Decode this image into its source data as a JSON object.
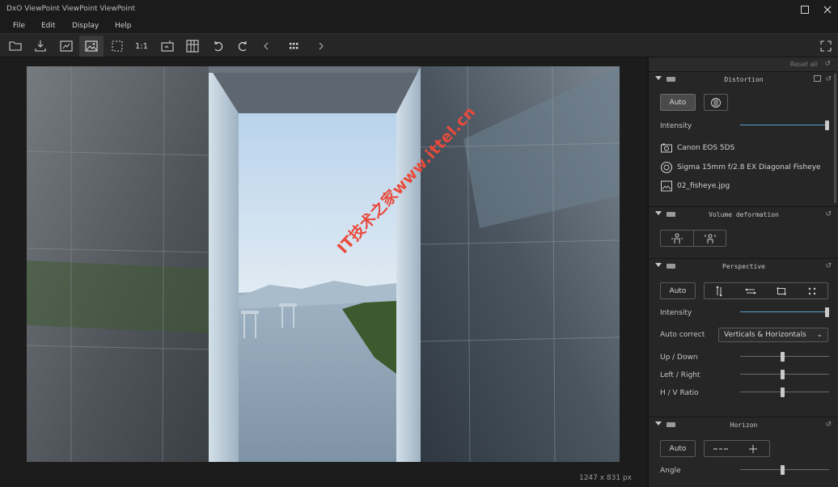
{
  "window": {
    "title": "DxO ViewPoint ViewPoint ViewPoint",
    "maximize_icon": "maximize-icon",
    "close_icon": "close-icon"
  },
  "menu": [
    "File",
    "Edit",
    "Display",
    "Help"
  ],
  "toolbar": {
    "items": [
      "open-icon",
      "export-icon",
      "compare-icon",
      "image-icon",
      "crop-icon",
      "1:1",
      "fit-icon",
      "grid-icon",
      "rotate-left-icon",
      "rotate-right-icon",
      "prev-icon",
      "thumbnails-icon",
      "next-icon",
      "fullscreen-icon"
    ],
    "zoom_label": "1:1"
  },
  "canvas": {
    "image_size": "1247 x 831 px"
  },
  "panel": {
    "reset_all": "Reset all",
    "distortion": {
      "title": "Distortion",
      "auto_label": "Auto",
      "intensity_label": "Intensity",
      "intensity_value": 1.0,
      "camera": "Canon EOS 5DS",
      "lens": "Sigma 15mm f/2.8 EX Diagonal Fisheye",
      "file": "02_fisheye.jpg"
    },
    "volume": {
      "title": "Volume deformation"
    },
    "perspective": {
      "title": "Perspective",
      "auto_label": "Auto",
      "intensity_label": "Intensity",
      "intensity_value": 1.0,
      "auto_correct_label": "Auto correct",
      "auto_correct_value": "Verticals & Horizontals",
      "up_down_label": "Up / Down",
      "left_right_label": "Left / Right",
      "hv_ratio_label": "H / V Ratio"
    },
    "horizon": {
      "title": "Horizon",
      "auto_label": "Auto",
      "angle_label": "Angle"
    }
  },
  "watermark": "IT技术之家www.ittel.cn",
  "colors": {
    "accent": "#5aa0d0",
    "background": "#1e1e1e",
    "panel": "#262626",
    "watermark": "#e84a3c"
  }
}
